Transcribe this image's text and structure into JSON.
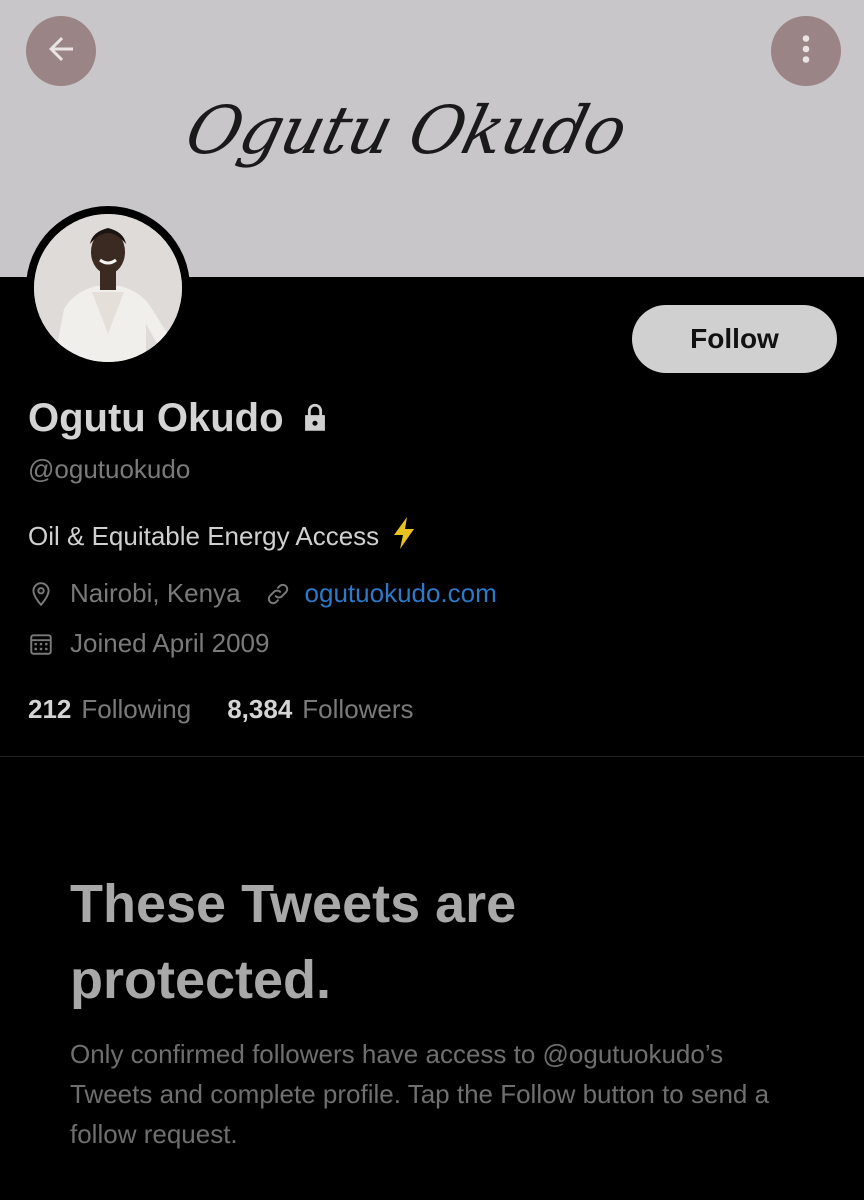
{
  "banner": {
    "signature_text": "Ogutu Okudo",
    "back_icon": "arrow-left-icon",
    "more_icon": "more-vertical-icon",
    "button_color": "#9b8486"
  },
  "profile": {
    "follow_label": "Follow",
    "name": "Ogutu Okudo",
    "handle": "@ogutuokudo",
    "bio": "Oil & Equitable Energy Access",
    "location": "Nairobi, Kenya",
    "website": "ogutuokudo.com",
    "joined": "Joined April 2009",
    "following_count": "212",
    "following_label": "Following",
    "followers_count": "8,384",
    "followers_label": "Followers"
  },
  "protected": {
    "title": "These Tweets are protected.",
    "body": "Only confirmed followers have access to @ogutuokudo’s Tweets and complete profile. Tap the Follow button to send a follow request."
  },
  "colors": {
    "background": "#000000",
    "link": "#2d79c7",
    "bolt": "#e8c21e"
  }
}
